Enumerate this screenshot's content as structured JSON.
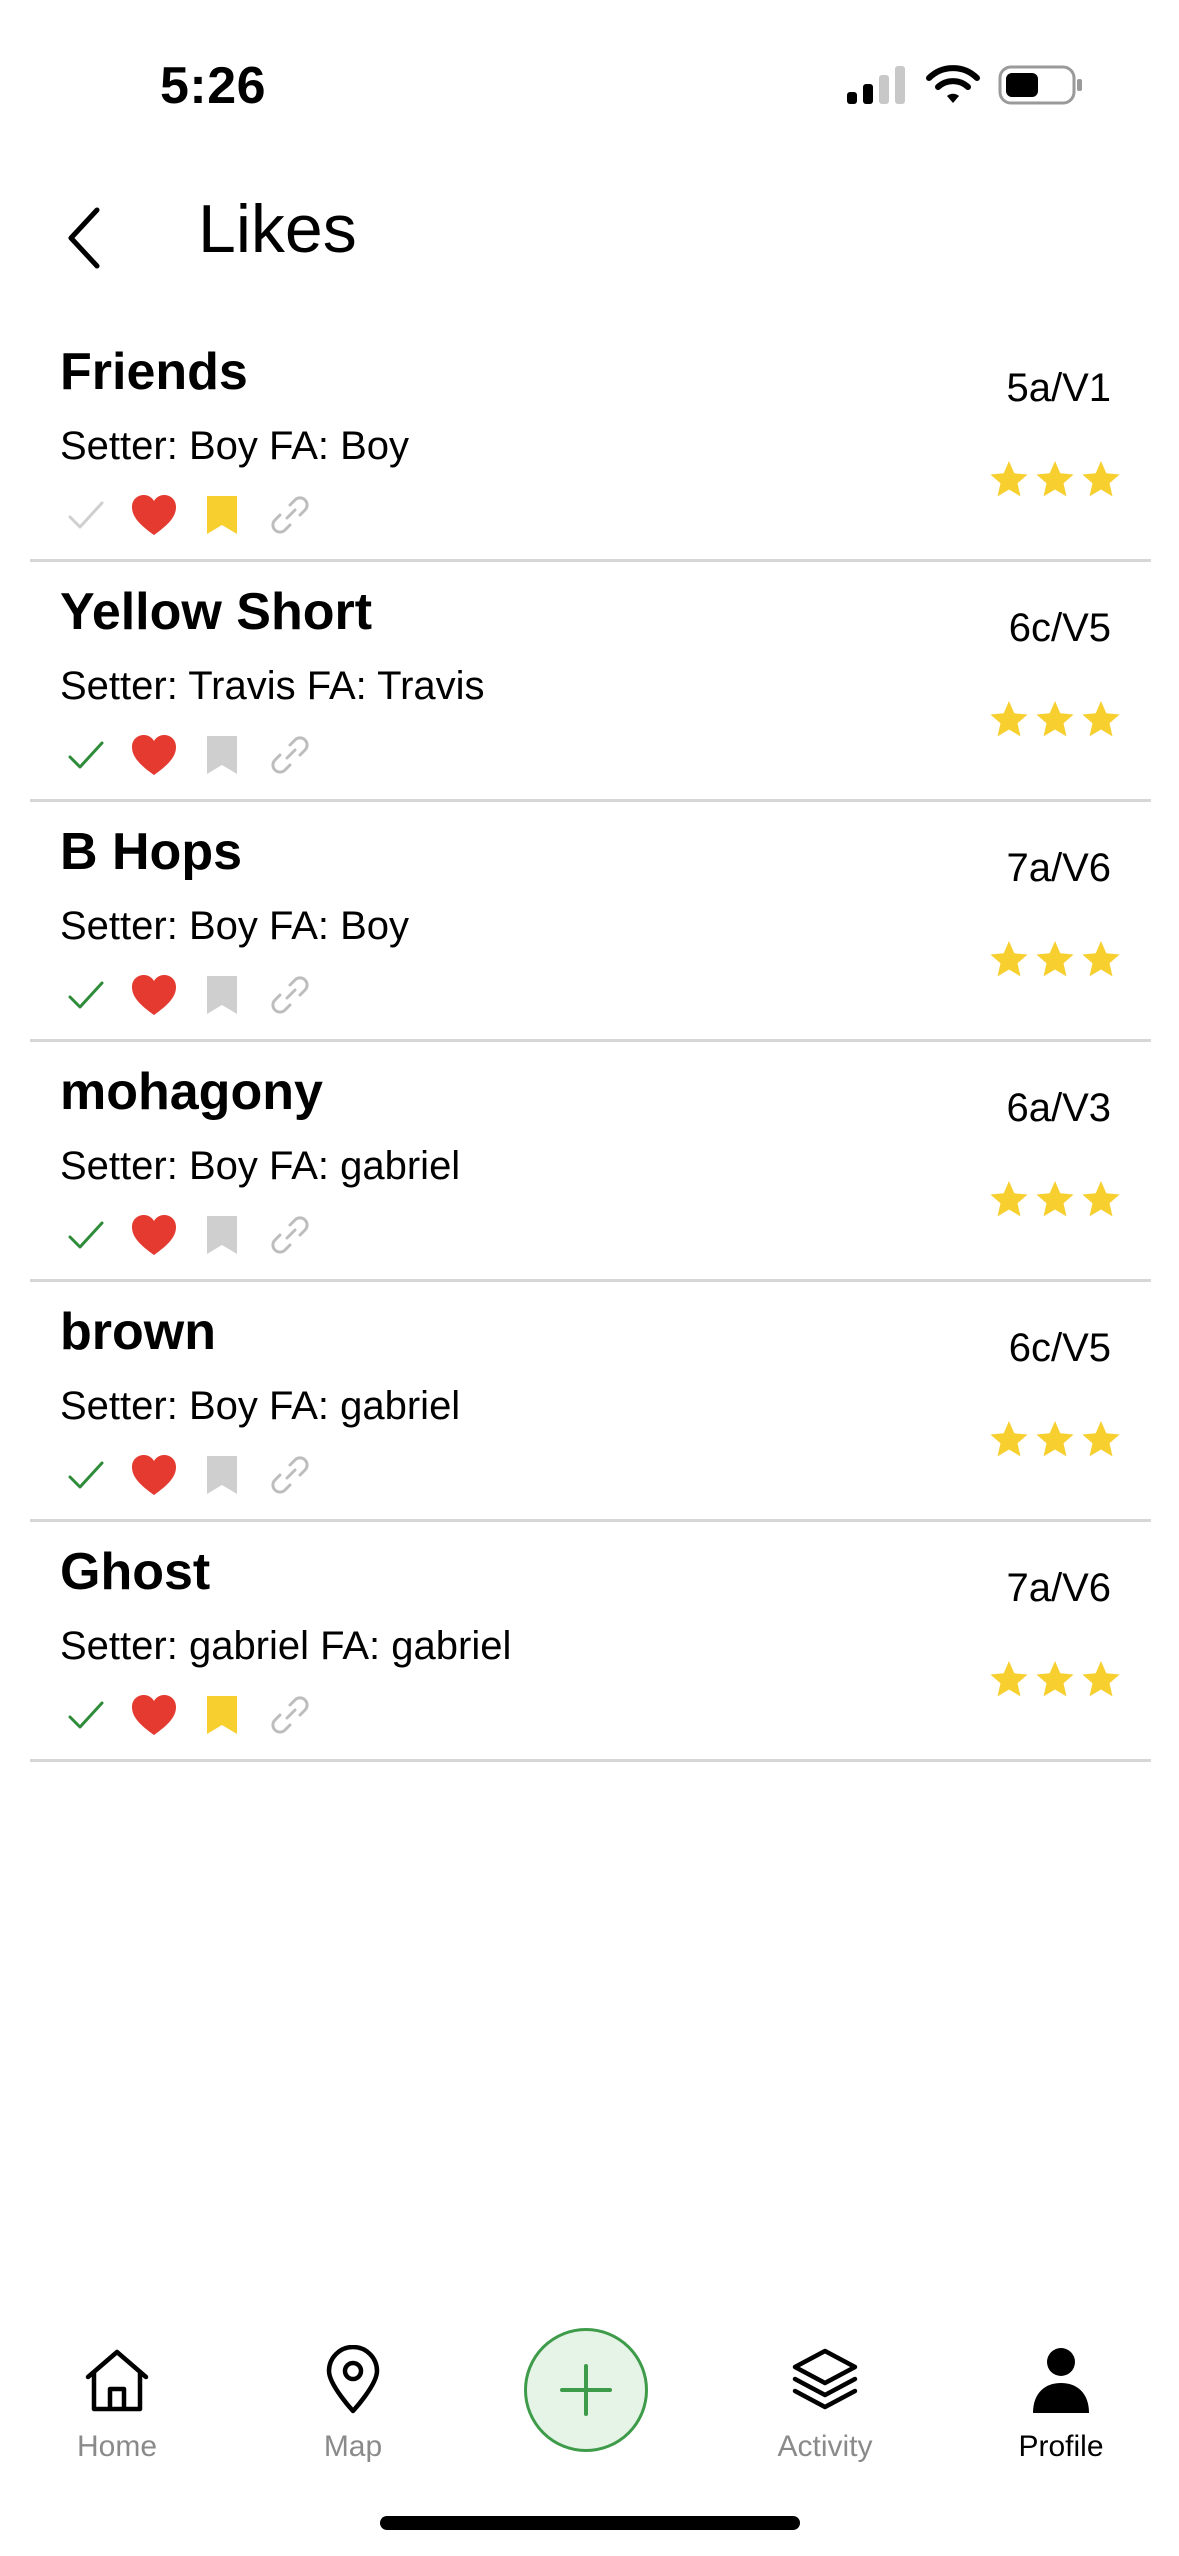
{
  "status_bar": {
    "time": "5:26"
  },
  "header": {
    "title": "Likes"
  },
  "colors": {
    "check_done": "#2e8b3a",
    "check_muted": "#cfcfcf",
    "heart": "#e53a2f",
    "bookmark_active": "#f7cf2f",
    "bookmark_muted": "#cfcfcf",
    "link": "#bdbdbd",
    "star": "#f7cf2f",
    "accent_green": "#3e9b4a"
  },
  "routes": [
    {
      "name": "Friends",
      "meta": "Setter: Boy FA: Boy",
      "grade": "5a/V1",
      "stars": 3,
      "sent": false,
      "liked": true,
      "bookmarked": true
    },
    {
      "name": "Yellow Short",
      "meta": "Setter: Travis FA: Travis",
      "grade": "6c/V5",
      "stars": 3,
      "sent": true,
      "liked": true,
      "bookmarked": false
    },
    {
      "name": "B Hops",
      "meta": "Setter: Boy FA: Boy",
      "grade": "7a/V6",
      "stars": 3,
      "sent": true,
      "liked": true,
      "bookmarked": false
    },
    {
      "name": "mohagony",
      "meta": "Setter: Boy FA: gabriel",
      "grade": "6a/V3",
      "stars": 3,
      "sent": true,
      "liked": true,
      "bookmarked": false
    },
    {
      "name": "brown",
      "meta": "Setter: Boy FA: gabriel",
      "grade": "6c/V5",
      "stars": 3,
      "sent": true,
      "liked": true,
      "bookmarked": false
    },
    {
      "name": "Ghost",
      "meta": "Setter: gabriel FA: gabriel",
      "grade": "7a/V6",
      "stars": 3,
      "sent": true,
      "liked": true,
      "bookmarked": true
    }
  ],
  "tab_bar": {
    "home": {
      "label": "Home",
      "icon": "home-icon"
    },
    "map": {
      "label": "Map",
      "icon": "map-pin-icon"
    },
    "add": {
      "icon": "plus-icon"
    },
    "activity": {
      "label": "Activity",
      "icon": "layers-icon"
    },
    "profile": {
      "label": "Profile",
      "icon": "person-icon"
    }
  }
}
